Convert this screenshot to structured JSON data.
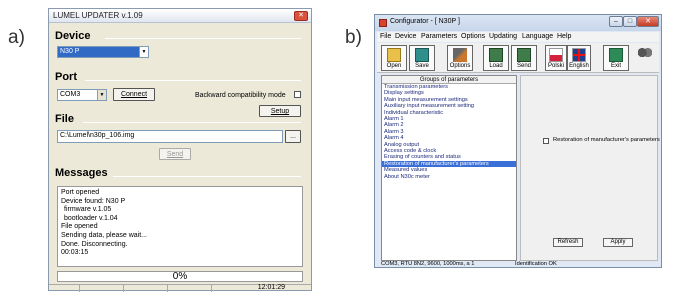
{
  "labels": {
    "a": "a)",
    "b": "b)"
  },
  "updater": {
    "title": "LUMEL UPDATER v.1.09",
    "device": {
      "heading": "Device",
      "selected": "N30 P"
    },
    "port": {
      "heading": "Port",
      "selected": "COM3",
      "connect_label": "Connect",
      "backward_label": "Backward compatibility mode",
      "setup_label": "Setup"
    },
    "file": {
      "heading": "File",
      "path": "C:\\Lumel\\n30p_106.img",
      "browse_label": "...",
      "send_label": "Send"
    },
    "messages": {
      "heading": "Messages",
      "lines": [
        "Port opened",
        "Device found: N30 P",
        " firmware v.1.05",
        " bootloader v.1.04",
        "File opened",
        "Sending data, please wait...",
        "Done. Disconnecting.",
        "00:03:15"
      ]
    },
    "progress": {
      "text": "0%",
      "value": 0
    },
    "status": {
      "time": "12:01:29"
    }
  },
  "configurator": {
    "title": "Configurator - [ N30P ]",
    "menu": [
      "File",
      "Device",
      "Parameters",
      "Options",
      "Updating",
      "Language",
      "Help"
    ],
    "toolbar": {
      "open": "Open",
      "save": "Save",
      "options": "Options",
      "load": "Load",
      "send": "Send",
      "polski": "Polski",
      "english": "English",
      "exit": "Exit"
    },
    "groups": {
      "header": "Groups of parameters",
      "items": [
        "Transmission parameters",
        "Display settings",
        "Main input measurement settings",
        "Auxiliary input measurement setting",
        "Individual characteristic",
        "Alarm 1",
        "Alarm 2",
        "Alarm 3",
        "Alarm 4",
        "Analog output",
        "Access code & clock",
        "Erasing of counters and status",
        "Restoration of manufacturer's parameters",
        "Measured values",
        "About N30c meter"
      ],
      "selected_index": 12
    },
    "restore_checkbox_label": "Restoration of manufacturer's parameters",
    "refresh_label": "Refresh",
    "apply_label": "Apply",
    "status_left": "COM3, RTU 8N2, 9600, 1000ms, a 1",
    "status_right": "Identification OK",
    "colors": {
      "selection": "#3a6fd8",
      "title_bg": "#dbe6f4"
    }
  }
}
